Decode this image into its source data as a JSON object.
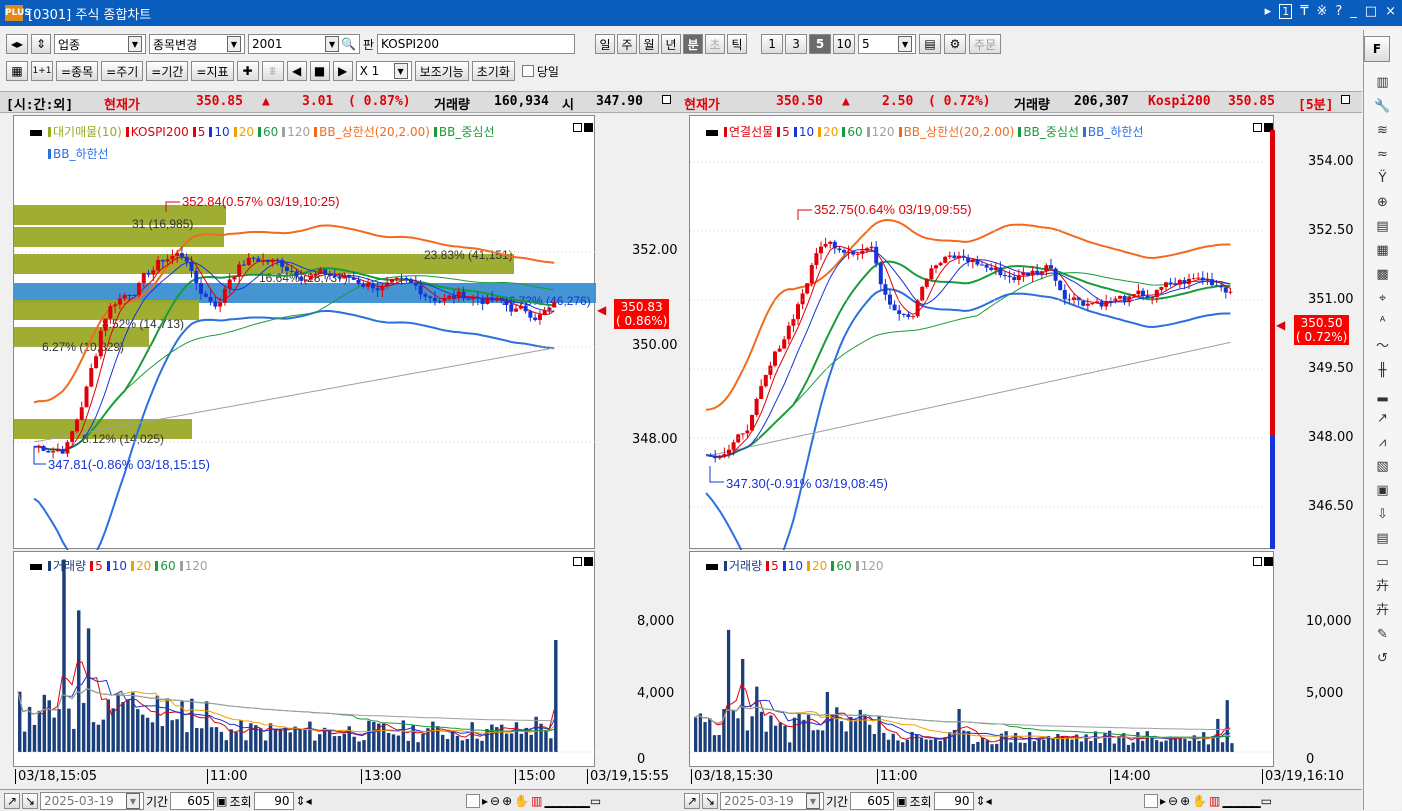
{
  "window": {
    "title": "[0301] 주식 종합차트",
    "logo": "PLUS",
    "controls": [
      "▸",
      "1",
      "₸",
      "※",
      "?",
      "_",
      "□",
      "×"
    ]
  },
  "toolbar1": {
    "sector": "업종",
    "stock_change": "종목변경",
    "code": "2001",
    "pan": "판",
    "name": "KOSPI200",
    "periods": [
      "일",
      "주",
      "월",
      "년",
      "분",
      "초",
      "틱"
    ],
    "active_period": "분",
    "intervals": [
      "1",
      "3",
      "5",
      "10"
    ],
    "active_interval": "5",
    "interval_value": "5",
    "order": "주문"
  },
  "toolbar2": {
    "items": [
      "=종목",
      "=주기",
      "=기간",
      "=지표"
    ],
    "multiplier": "X 1",
    "aux_label": "보조기능",
    "reset_label": "초기화",
    "today_label": "당일"
  },
  "infobar": {
    "left": {
      "tag": "[시:간:외]",
      "price_label": "현재가",
      "price": "350.85",
      "change": "3.01",
      "pct": "( 0.87%)",
      "vol_label": "거래량",
      "volume": "160,934",
      "open_label": "시",
      "open": "347.90"
    },
    "right": {
      "price_label": "현재가",
      "price": "350.50",
      "change": "2.50",
      "pct": "( 0.72%)",
      "vol_label": "거래량",
      "volume": "206,307",
      "idx_label": "Kospi200",
      "idx": "350.85",
      "period": "[5분]"
    }
  },
  "left_price": {
    "legend1": [
      "대기매물(10)",
      "KOSPI200",
      "5",
      "10",
      "20",
      "60",
      "120",
      "BB_상한선(20,2.00)",
      "BB_중심선"
    ],
    "legend2": [
      "BB_하한선"
    ],
    "y_ticks": [
      "352.00",
      "350.00",
      "348.00"
    ],
    "current_box": [
      "350.83",
      "( 0.86%)"
    ],
    "high_annotation": "352.84(0.57% 03/19,10:25)",
    "low_annotation": "347.81(-0.86% 03/18,15:15)",
    "profile_labels": [
      "31 (16,985)",
      "23.83% (41,151)",
      "16.64% (28,737)",
      "26.73% (46,276)",
      "8.52% (14,713)",
      "6.27% (10,829)",
      "8.12% (14,025)"
    ]
  },
  "left_volume": {
    "legend": [
      "거래량",
      "5",
      "10",
      "20",
      "60",
      "120"
    ],
    "y_ticks": [
      "8,000",
      "4,000",
      "0"
    ],
    "x_ticks": [
      "03/18,15:05",
      "11:00",
      "13:00",
      "15:00",
      "03/19,15:55"
    ]
  },
  "right_price": {
    "legend": [
      "연결선물",
      "5",
      "10",
      "20",
      "60",
      "120",
      "BB_상한선(20,2.00)",
      "BB_중심선",
      "BB_하한선"
    ],
    "y_ticks": [
      "354.00",
      "352.50",
      "351.00",
      "349.50",
      "348.00",
      "346.50"
    ],
    "current_box": [
      "350.50",
      "( 0.72%)"
    ],
    "high_annotation": "352.75(0.64% 03/19,09:55)",
    "low_annotation": "347.30(-0.91% 03/19,08:45)"
  },
  "right_volume": {
    "legend": [
      "거래량",
      "5",
      "10",
      "20",
      "60",
      "120"
    ],
    "y_ticks": [
      "10,000",
      "5,000",
      "0"
    ],
    "x_ticks": [
      "03/18,15:30",
      "11:00",
      "14:00",
      "03/19,16:10"
    ]
  },
  "bottom_left": {
    "date": "2025-03-19",
    "period_label": "기간",
    "count": "605",
    "query_label": "조회",
    "view": "90"
  },
  "bottom_right": {
    "date": "2025-03-19",
    "period_label": "기간",
    "count": "605",
    "query_label": "조회",
    "view": "90"
  },
  "sidebar": {
    "top": "F",
    "icons": [
      "chart-icon",
      "wrench-icon",
      "price-icon",
      "trade-icon",
      "compare-icon",
      "zoom-icon",
      "list-icon",
      "search-doc-icon",
      "search-doc2-icon",
      "crosshair-icon",
      "auto-icon",
      "trend-icon",
      "candle-icon",
      "bar-icon",
      "signal-icon",
      "line-icon",
      "grid-icon",
      "window-icon",
      "download-icon",
      "news-icon",
      "frame-icon",
      "order-icon",
      "order2-icon",
      "edit-icon",
      "refresh-icon"
    ]
  },
  "colors": {
    "up": "#e0000a",
    "down": "#1633d8",
    "bb_upper": "#f26b1d",
    "bb_mid": "#1a9b3a",
    "bb_lower": "#2b6fe0",
    "ma120": "#a0a0a0",
    "profile": "#9aaa28",
    "profile_hl": "#3a8fd0",
    "vol": "#1b3f7a"
  }
}
